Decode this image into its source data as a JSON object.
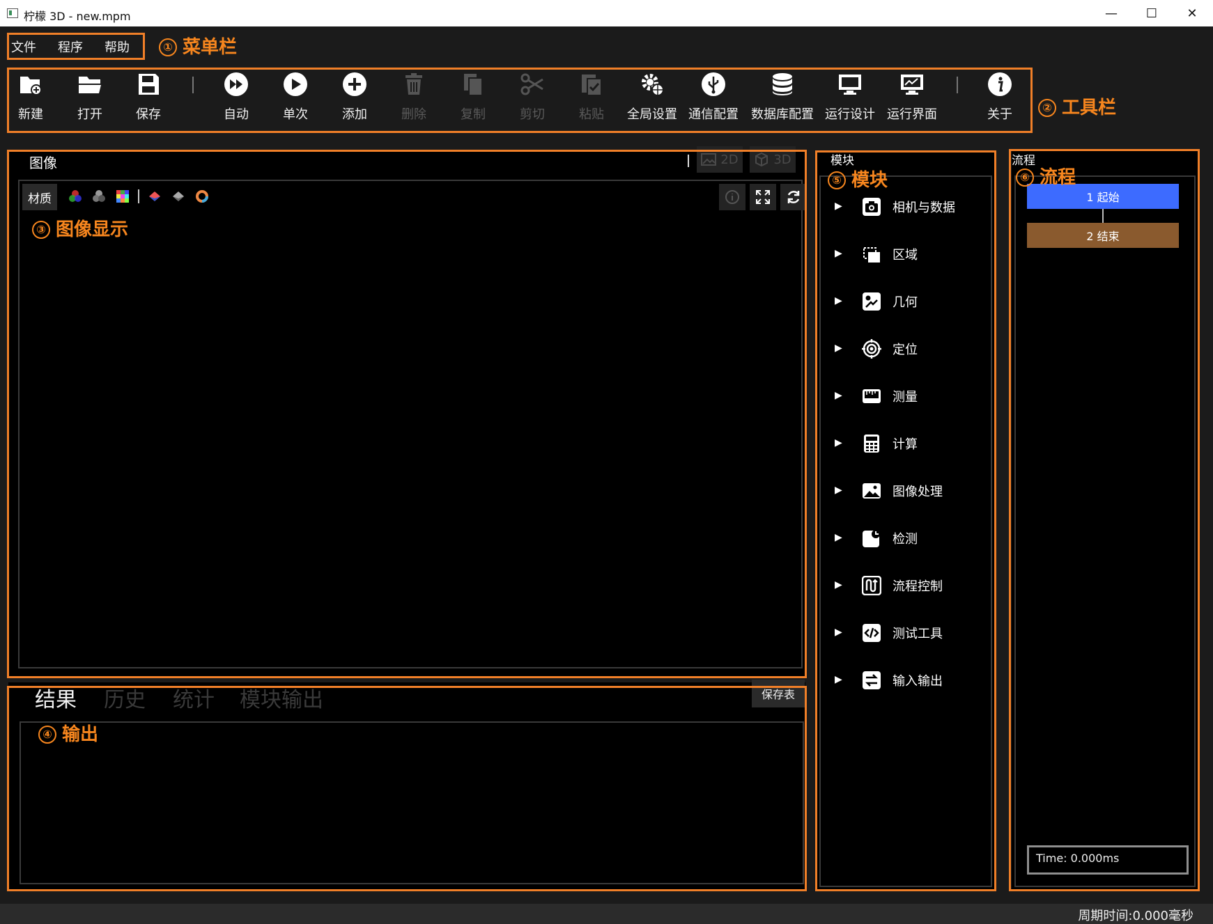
{
  "window": {
    "title": "柠檬 3D  - new.mpm",
    "minimize": "—",
    "maximize": "☐",
    "close": "✕"
  },
  "menu": {
    "items": [
      "文件",
      "程序",
      "帮助"
    ]
  },
  "toolbar": {
    "items": [
      {
        "label": "新建",
        "icon": "new-folder-icon",
        "enabled": true
      },
      {
        "label": "打开",
        "icon": "open-folder-icon",
        "enabled": true
      },
      {
        "label": "保存",
        "icon": "save-icon",
        "enabled": true
      },
      {
        "label": "自动",
        "icon": "fast-forward-icon",
        "enabled": true
      },
      {
        "label": "单次",
        "icon": "play-icon",
        "enabled": true
      },
      {
        "label": "添加",
        "icon": "add-icon",
        "enabled": true
      },
      {
        "label": "删除",
        "icon": "trash-icon",
        "enabled": false
      },
      {
        "label": "复制",
        "icon": "copy-icon",
        "enabled": false
      },
      {
        "label": "剪切",
        "icon": "scissors-icon",
        "enabled": false
      },
      {
        "label": "粘贴",
        "icon": "paste-icon",
        "enabled": false
      },
      {
        "label": "全局设置",
        "icon": "gear-globe-icon",
        "enabled": true
      },
      {
        "label": "通信配置",
        "icon": "usb-icon",
        "enabled": true
      },
      {
        "label": "数据库配置",
        "icon": "database-icon",
        "enabled": true
      },
      {
        "label": "运行设计",
        "icon": "monitor-icon",
        "enabled": true
      },
      {
        "label": "运行界面",
        "icon": "chart-monitor-icon",
        "enabled": true
      },
      {
        "label": "关于",
        "icon": "info-icon",
        "enabled": true
      }
    ]
  },
  "annotations": {
    "menu": {
      "num": "①",
      "text": "菜单栏"
    },
    "toolbar": {
      "num": "②",
      "text": "工具栏"
    },
    "image": {
      "num": "③",
      "text": "图像显示"
    },
    "output": {
      "num": "④",
      "text": "输出"
    },
    "module": {
      "num": "⑤",
      "text": "模块"
    },
    "flow": {
      "num": "⑥",
      "text": "流程"
    }
  },
  "image_panel": {
    "title": "图像",
    "mode_2d": "2D",
    "mode_3d": "3D",
    "material": "材质"
  },
  "output_panel": {
    "tabs": [
      "结果",
      "历史",
      "统计",
      "模块输出"
    ],
    "active_tab": 0,
    "save_button": "保存表"
  },
  "module_panel": {
    "title": "模块",
    "items": [
      {
        "label": "相机与数据",
        "icon": "camera-icon"
      },
      {
        "label": "区域",
        "icon": "region-icon"
      },
      {
        "label": "几何",
        "icon": "geometry-icon"
      },
      {
        "label": "定位",
        "icon": "target-icon"
      },
      {
        "label": "测量",
        "icon": "ruler-icon"
      },
      {
        "label": "计算",
        "icon": "calculator-icon"
      },
      {
        "label": "图像处理",
        "icon": "image-icon"
      },
      {
        "label": "检测",
        "icon": "detect-icon"
      },
      {
        "label": "流程控制",
        "icon": "flow-control-icon"
      },
      {
        "label": "测试工具",
        "icon": "code-icon"
      },
      {
        "label": "输入输出",
        "icon": "io-icon"
      }
    ]
  },
  "flow_panel": {
    "title": "流程",
    "nodes": [
      {
        "label": "1 起始",
        "color": "#3d6bff"
      },
      {
        "label": "2 结束",
        "color": "#8a5a2e"
      }
    ],
    "time": "Time: 0.000ms"
  },
  "status": {
    "cycle_time": "周期时间:0.000毫秒"
  },
  "colors": {
    "annotation": "#f07f28",
    "background": "#1b1b1b",
    "panel": "#000000"
  }
}
